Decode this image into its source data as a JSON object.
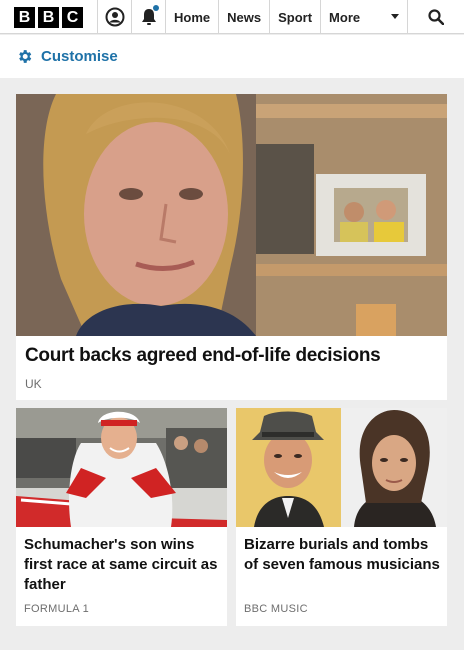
{
  "header": {
    "logo_letters": [
      "B",
      "B",
      "C"
    ],
    "nav": {
      "home": "Home",
      "news": "News",
      "sport": "Sport",
      "more": "More"
    }
  },
  "customise": {
    "label": "Customise",
    "icon": "gear-icon"
  },
  "hero": {
    "title": "Court backs agreed end-of-life decisions",
    "tag": "UK"
  },
  "cards": [
    {
      "title": "Schumacher's son wins first race at same circuit as father",
      "tag": "FORMULA 1"
    },
    {
      "title": "Bizarre burials and tombs of seven famous musicians",
      "tag": "BBC MUSIC"
    }
  ],
  "colors": {
    "accent": "#1f72a8",
    "notification_dot": "#1f72a8",
    "page_bg": "#ededed"
  }
}
